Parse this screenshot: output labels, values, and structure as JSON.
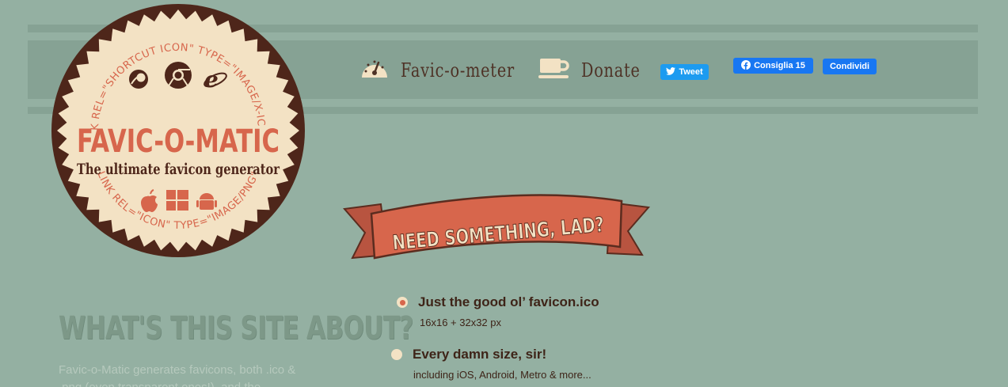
{
  "header": {
    "nav": [
      {
        "label": "Favic-o-meter",
        "icon": "gauge-icon"
      },
      {
        "label": "Donate",
        "icon": "coffee-cup-icon"
      }
    ],
    "social": {
      "tweet_label": "Tweet",
      "fb_like_label": "Consiglia 15",
      "fb_share_label": "Condividi"
    }
  },
  "logo": {
    "title": "FAVIC-O-MATIC",
    "tagline": "The ultimate favicon generator",
    "top_arc": "LINK REL=\"SHORTCUT ICON\" TYPE=\"IMAGE/X-ICON\"",
    "bottom_arc": "LINK REL=\"ICON\" TYPE=\"IMAGE/PNG\"",
    "browser_icons": [
      "firefox-icon",
      "chrome-icon",
      "internet-explorer-icon"
    ],
    "platform_icons": [
      "apple-icon",
      "windows-icon",
      "android-icon"
    ]
  },
  "banner": {
    "text": "NEED SOMETHING, LAD?"
  },
  "options": [
    {
      "label": "Just the good ol’ favicon.ico",
      "sub": "16x16 + 32x32 px",
      "selected": true
    },
    {
      "label": "Every damn size, sir!",
      "sub": "including iOS, Android, Metro & more...",
      "selected": false
    }
  ],
  "about": {
    "title": "WHAT'S THIS SITE ABOUT?",
    "text": "Favic-o-Matic generates favicons, both .ico & .png (even transparent ones!), and the"
  },
  "colors": {
    "background": "#94b0a2",
    "band": "#86a294",
    "cream": "#f3e2c4",
    "red": "#d7664c",
    "brown": "#4a2a1e"
  }
}
